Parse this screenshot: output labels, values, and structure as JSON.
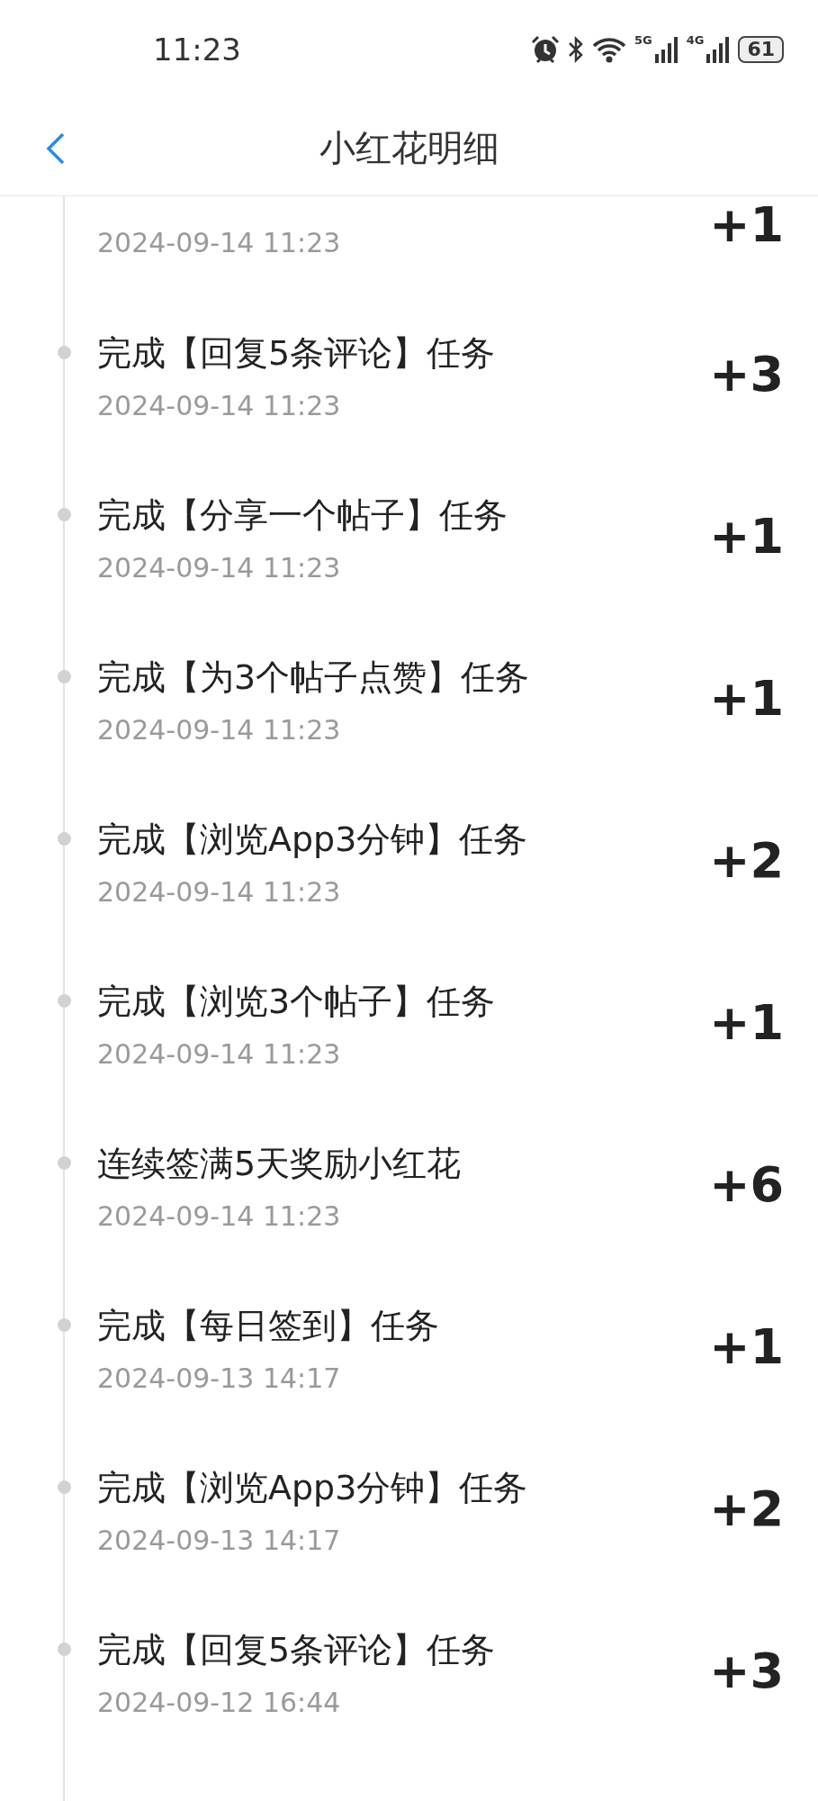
{
  "status_bar": {
    "time": "11:23",
    "network_1": "5G",
    "network_2": "4G",
    "battery": "61"
  },
  "header": {
    "title": "小红花明细"
  },
  "records": [
    {
      "date": "2024-09-14 11:23",
      "points": "+1"
    },
    {
      "title": "完成【回复5条评论】任务",
      "date": "2024-09-14 11:23",
      "points": "+3"
    },
    {
      "title": "完成【分享一个帖子】任务",
      "date": "2024-09-14 11:23",
      "points": "+1"
    },
    {
      "title": "完成【为3个帖子点赞】任务",
      "date": "2024-09-14 11:23",
      "points": "+1"
    },
    {
      "title": "完成【浏览App3分钟】任务",
      "date": "2024-09-14 11:23",
      "points": "+2"
    },
    {
      "title": "完成【浏览3个帖子】任务",
      "date": "2024-09-14 11:23",
      "points": "+1"
    },
    {
      "title": "连续签满5天奖励小红花",
      "date": "2024-09-14 11:23",
      "points": "+6"
    },
    {
      "title": "完成【每日签到】任务",
      "date": "2024-09-13 14:17",
      "points": "+1"
    },
    {
      "title": "完成【浏览App3分钟】任务",
      "date": "2024-09-13 14:17",
      "points": "+2"
    },
    {
      "title": "完成【回复5条评论】任务",
      "date": "2024-09-12 16:44",
      "points": "+3"
    }
  ]
}
